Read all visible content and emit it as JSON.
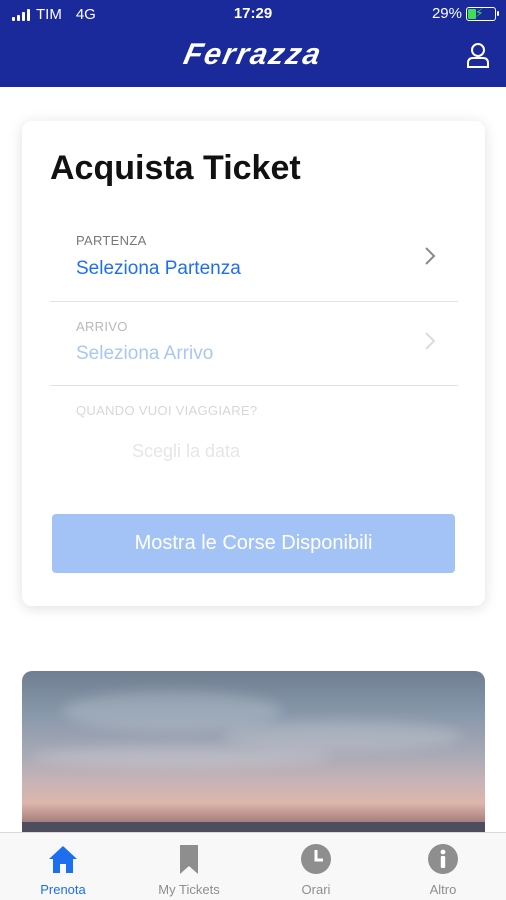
{
  "status_bar": {
    "carrier": "TIM",
    "network": "4G",
    "time": "17:29",
    "battery": "29%"
  },
  "header": {
    "logo": "Ferrazza",
    "user_icon": "user-icon"
  },
  "card": {
    "title": "Acquista Ticket",
    "departure": {
      "label": "PARTENZA",
      "value": "Seleziona Partenza"
    },
    "arrival": {
      "label": "ARRIVO",
      "value": "Seleziona Arrivo"
    },
    "date": {
      "label": "QUANDO VUOI VIAGGIARE?",
      "value": "Scegli la data"
    },
    "button_label": "Mostra le Corse Disponibili"
  },
  "tabs": [
    {
      "label": "Prenota",
      "icon": "home-icon",
      "active": true
    },
    {
      "label": "My Tickets",
      "icon": "bookmark-icon",
      "active": false
    },
    {
      "label": "Orari",
      "icon": "clock-icon",
      "active": false
    },
    {
      "label": "Altro",
      "icon": "info-icon",
      "active": false
    }
  ],
  "colors": {
    "header_bg": "#1a2a9a",
    "accent": "#1e6ff0",
    "button_disabled": "#a3c3f7",
    "battery_green": "#3fdd5a"
  }
}
